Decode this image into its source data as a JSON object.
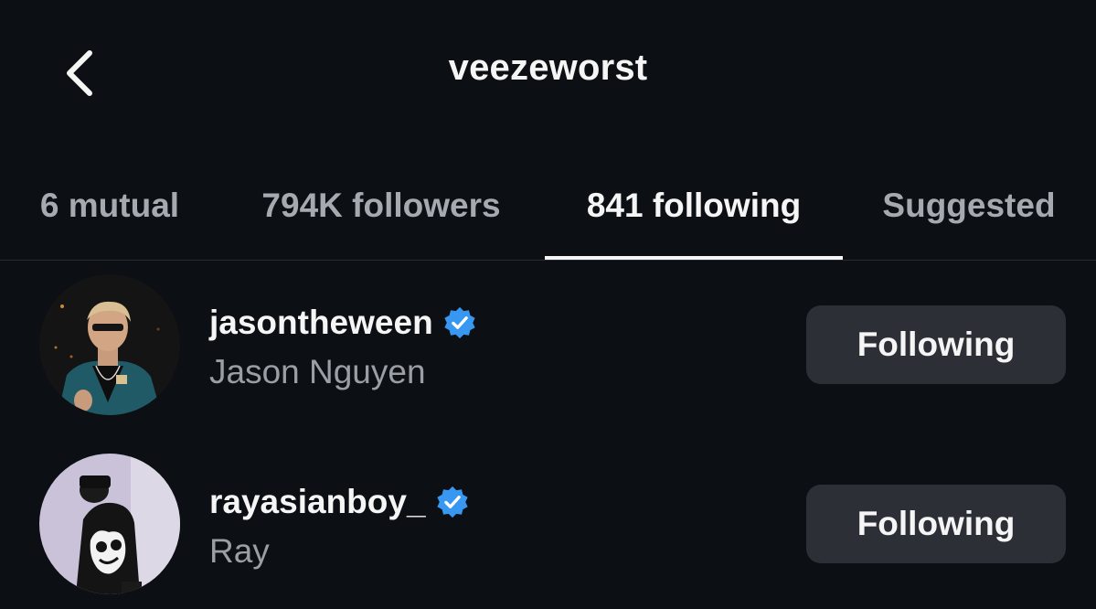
{
  "header": {
    "title": "veezeworst",
    "back_icon": "chevron-left-icon"
  },
  "tabs": [
    {
      "label": "6 mutual",
      "active": false
    },
    {
      "label": "794K followers",
      "active": false
    },
    {
      "label": "841 following",
      "active": true
    },
    {
      "label": "Suggested",
      "active": false
    }
  ],
  "list": [
    {
      "username": "jasontheween",
      "full_name": "Jason Nguyen",
      "verified": true,
      "button_label": "Following"
    },
    {
      "username": "rayasianboy_",
      "full_name": "Ray",
      "verified": true,
      "button_label": "Following"
    }
  ],
  "colors": {
    "background": "#0c0f14",
    "verified_badge": "#3897f0",
    "button_bg": "#2c2f36",
    "secondary_text": "#9b9ea4"
  }
}
